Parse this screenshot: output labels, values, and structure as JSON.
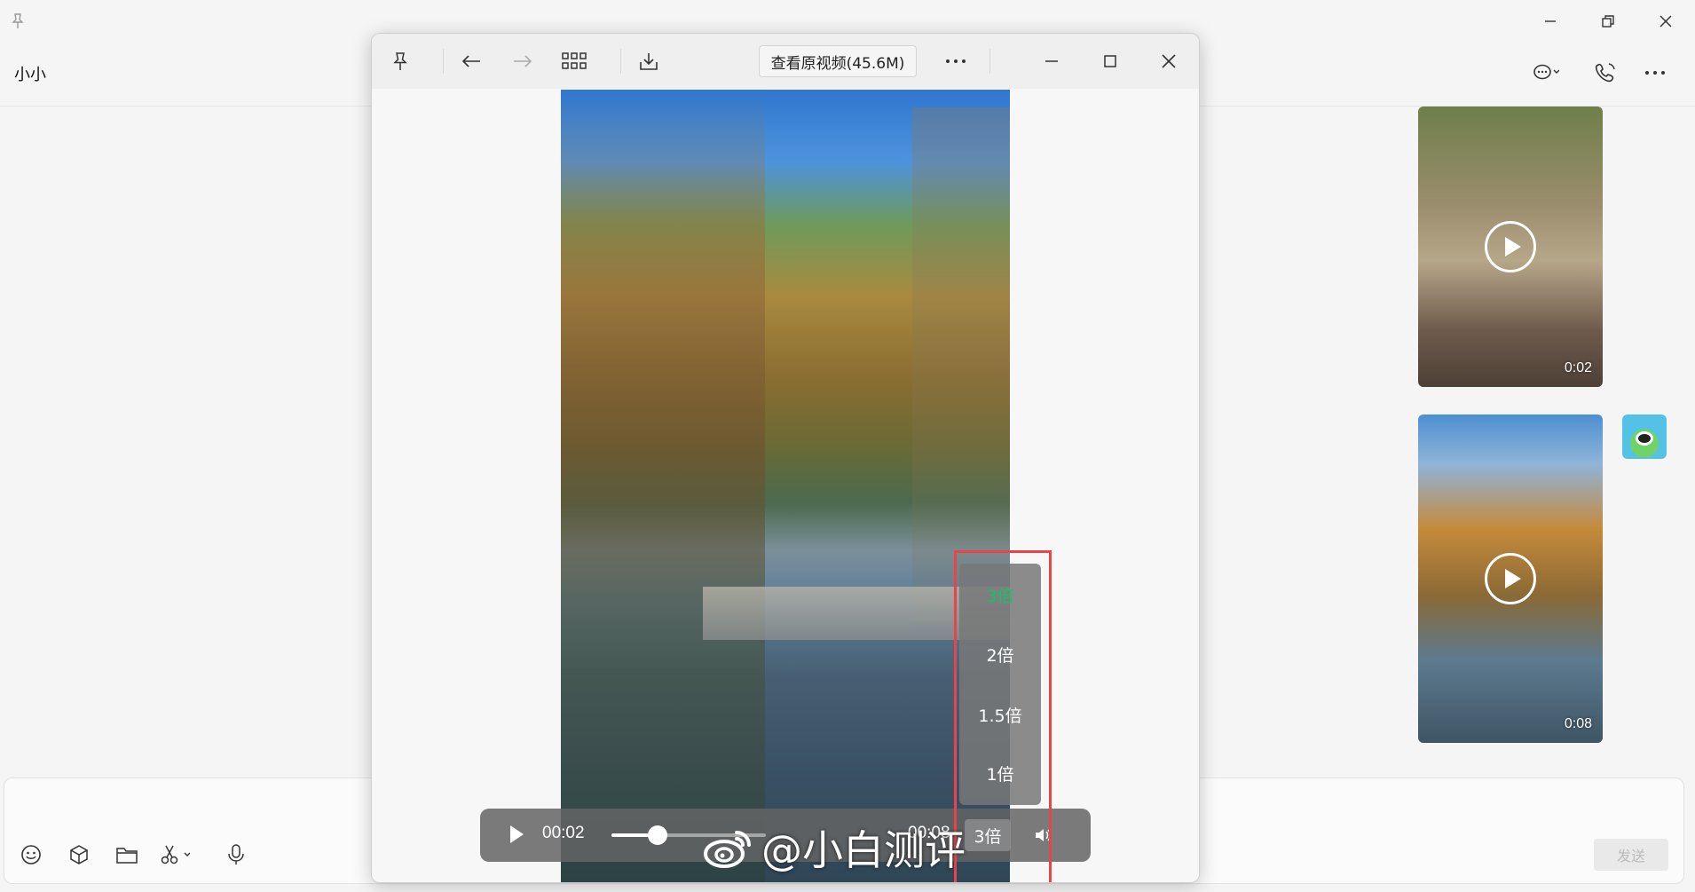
{
  "chat": {
    "title": "小小",
    "messages": [
      {
        "type": "video",
        "duration": "0:02"
      },
      {
        "type": "video",
        "duration": "0:08"
      }
    ],
    "send_label": "发送"
  },
  "viewer": {
    "view_original_label": "查看原视频(45.6M)",
    "speed_menu": {
      "options": [
        "3倍",
        "2倍",
        "1.5倍",
        "1倍"
      ],
      "selected": "3倍"
    },
    "controls": {
      "current_time": "00:02",
      "total_time": "00:08",
      "speed_label": "3倍",
      "progress": 0.3
    }
  },
  "watermark": {
    "text": "@小白测评"
  },
  "colors": {
    "accent_green": "#15c26b",
    "highlight_red": "#e8454a"
  }
}
